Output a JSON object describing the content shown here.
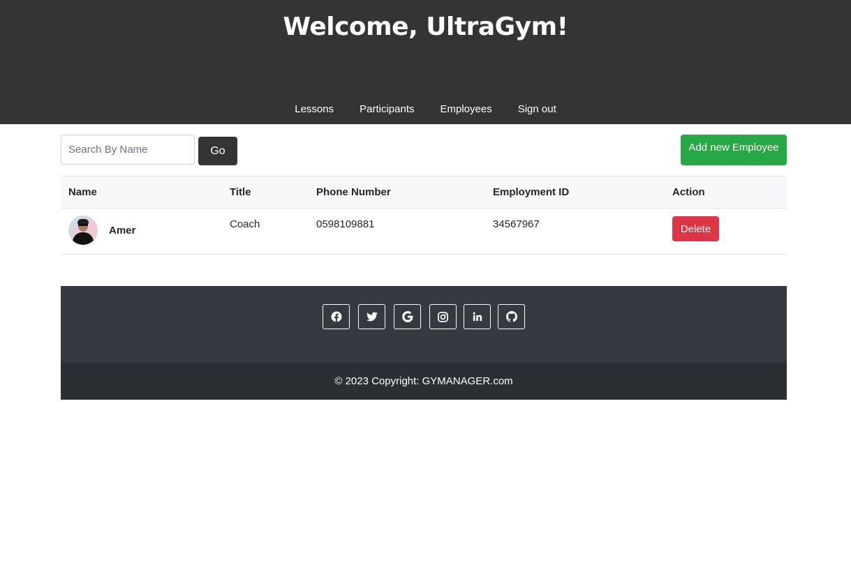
{
  "header": {
    "title": "Welcome, UltraGym!",
    "nav": [
      {
        "label": "Lessons"
      },
      {
        "label": "Participants"
      },
      {
        "label": "Employees"
      },
      {
        "label": "Sign out"
      }
    ]
  },
  "toolbar": {
    "search_placeholder": "Search By Name",
    "search_value": "",
    "go_label": "Go",
    "add_label": "Add new Employee"
  },
  "table": {
    "headers": {
      "name": "Name",
      "title": "Title",
      "phone": "Phone Number",
      "employment_id": "Employment ID",
      "action": "Action"
    },
    "rows": [
      {
        "name": "Amer",
        "title": "Coach",
        "phone": "0598109881",
        "employment_id": "34567967",
        "action_label": "Delete"
      }
    ]
  },
  "footer": {
    "social_icons": [
      "facebook-icon",
      "twitter-icon",
      "google-icon",
      "instagram-icon",
      "linkedin-icon",
      "github-icon"
    ],
    "copyright": "© 2023 Copyright: GYMANAGER.com"
  },
  "colors": {
    "header_bg": "#343434",
    "add_button": "#28a745",
    "delete_button": "#dc3545",
    "footer_top": "#343a40",
    "footer_bottom": "#2b2e32"
  }
}
